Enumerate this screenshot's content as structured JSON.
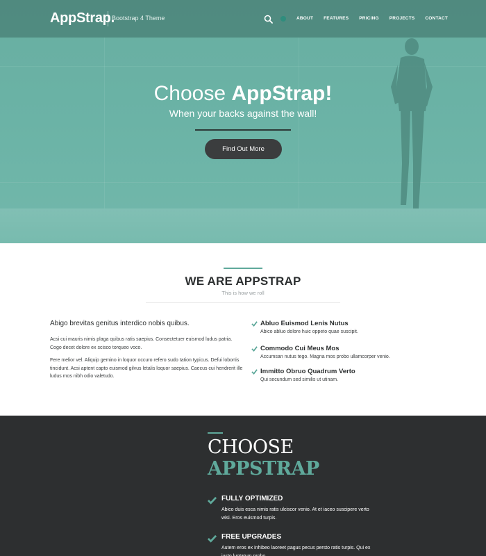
{
  "nav": {
    "brand": "AppStrap.",
    "tagline": "Bootstrap 4 Theme",
    "search_icon": "search-icon",
    "links": [
      "ABOUT",
      "FEATURES",
      "PRICING",
      "PROJECTS",
      "CONTACT"
    ]
  },
  "hero": {
    "title_light": "Choose ",
    "title_bold": "AppStrap!",
    "subtitle": "When your backs against the wall!",
    "button_label": "Find Out More"
  },
  "about": {
    "title": "WE ARE APPSTRAP",
    "subtitle": "This is how we roll",
    "lead": "Abigo brevitas genitus interdico nobis quibus.",
    "paragraphs": [
      "Acsi cui mauris nimis plaga quibus ratis saepius. Consectetuer euismod ludus patria. Cogo decet dolore ex scisco torqueo voco.",
      "Fere melior vel. Aliquip gemino in loquor occuro refero sudo tation typicus. Defui lobortis tincidunt. Acsi aptent capto euismod gilvus letalis loquor saepius. Caecus cui hendrerit ille ludus mos nibh odio valetudo."
    ],
    "features": [
      {
        "title": "Abluo Euismod Lenis Nutus",
        "text": "Abico abluo dolore huic oppeto quae suscipit."
      },
      {
        "title": "Commodo Cui Meus Mos",
        "text": "Accumsan nutus tego. Magna mos probo ullamcorper venio."
      },
      {
        "title": "Immitto Obruo Quadrum Verto",
        "text": "Qui secundum sed similis ut utinam."
      }
    ]
  },
  "choose": {
    "title_line1": "CHOOSE",
    "title_line2": "APPSTRAP",
    "features": [
      {
        "title": "FULLY OPTIMIZED",
        "text": "Abico duis esca nimis ratis ulciscor venio. At et iaceo suscipere verto wisi. Eros euismod turpis."
      },
      {
        "title": "FREE UPGRADES",
        "text": "Autem eros ex inhibeo laoreet pagus pecus persto ratis turpis. Qui ex iusto luptatum probo."
      }
    ]
  },
  "colors": {
    "accent": "#5fa99b",
    "hero_bg": "#6bb3a6",
    "dark_bg": "#2d2f30",
    "button_bg": "#3b3d3e"
  }
}
